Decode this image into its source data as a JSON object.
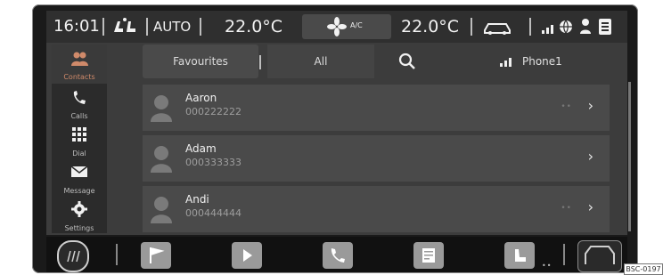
{
  "status": {
    "time": "16:01",
    "mode": "AUTO",
    "temp_left": "22.0°C",
    "ac_label": "A/C",
    "temp_right": "22.0°C"
  },
  "sidebar": {
    "items": [
      {
        "label": "Contacts",
        "active": true,
        "icon": "contacts-icon"
      },
      {
        "label": "Calls",
        "active": false,
        "icon": "phone-handset-icon"
      },
      {
        "label": "Dial",
        "active": false,
        "icon": "keypad-icon"
      },
      {
        "label": "Message",
        "active": false,
        "icon": "envelope-icon"
      },
      {
        "label": "Settings",
        "active": false,
        "icon": "gear-icon"
      }
    ]
  },
  "tabs": {
    "favourites": "Favourites",
    "all": "All",
    "device": "Phone1"
  },
  "contacts": [
    {
      "name": "Aaron",
      "number": "000222222"
    },
    {
      "name": "Adam",
      "number": "000333333"
    },
    {
      "name": "Andi",
      "number": "000444444"
    }
  ],
  "figure_code": "BSC-0197",
  "colors": {
    "screen_bg": "#3c3c3c",
    "active_accent": "#d08a6a",
    "row_bg": "#4a4a4a"
  }
}
